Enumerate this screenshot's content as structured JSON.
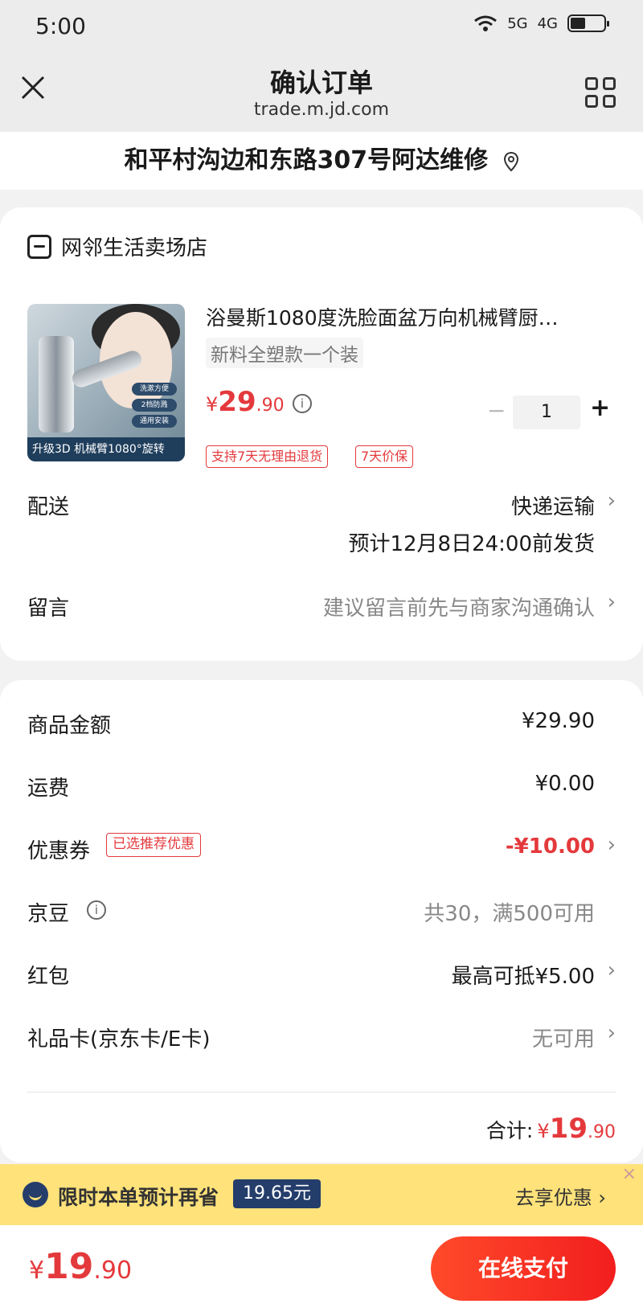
{
  "status": {
    "time": "5:00",
    "signal1": "5G",
    "signal2": "4G"
  },
  "nav": {
    "title": "确认订单",
    "url": "trade.m.jd.com"
  },
  "address": {
    "text": "和平村沟边和东路307号阿达维修"
  },
  "shop": {
    "name": "网邻生活卖场店"
  },
  "product": {
    "title": "浴曼斯1080度洗脸面盆万向机械臂厨…",
    "spec": "新料全塑款一个装",
    "price_currency": "¥",
    "price_int": "29",
    "price_dec": ".90",
    "quantity": "1",
    "minus": "−",
    "plus": "+",
    "badges": [
      "支持7天无理由退货",
      "7天价保"
    ],
    "image_tags": [
      "洗漱方便",
      "2档防溅",
      "通用安装"
    ],
    "image_banner": "升级3D 机械臂1080°旋转"
  },
  "delivery": {
    "label": "配送",
    "method": "快递运输",
    "estimate": "预计12月8日24:00前发货"
  },
  "note": {
    "label": "留言",
    "placeholder": "建议留言前先与商家沟通确认"
  },
  "summary": {
    "goods_label": "商品金额",
    "goods_value": "¥29.90",
    "shipping_label": "运费",
    "shipping_value": "¥0.00",
    "coupon_label": "优惠券",
    "coupon_badge": "已选推荐优惠",
    "coupon_value": "-¥10.00",
    "beans_label": "京豆",
    "beans_value": "共30，满500可用",
    "redpacket_label": "红包",
    "redpacket_value": "最高可抵¥5.00",
    "giftcard_label": "礼品卡(京东卡/E卡)",
    "giftcard_value": "无可用",
    "total_label": "合计:",
    "total_currency": "¥",
    "total_int": "19",
    "total_dec": ".90"
  },
  "promo": {
    "text": "限时本单预计再省",
    "amount": "19.65元",
    "link": "去享优惠",
    "close": "×"
  },
  "footer": {
    "currency": "¥",
    "int": "19",
    "dec": ".90",
    "pay_label": "在线支付"
  },
  "colors": {
    "accent": "#e4393c",
    "pay_button": "#f53322",
    "promo_bg": "#ffe27a",
    "promo_badge": "#243d6b"
  }
}
